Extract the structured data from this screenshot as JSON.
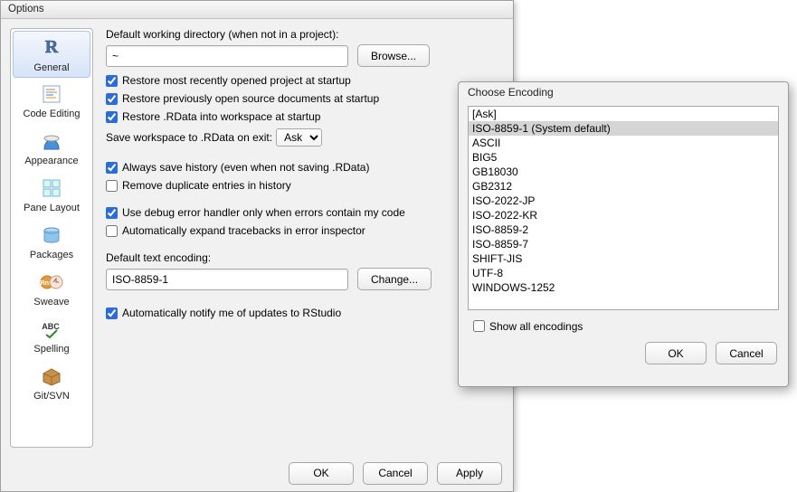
{
  "options": {
    "title": "Options",
    "sidebar": {
      "items": [
        {
          "key": "general",
          "label": "General"
        },
        {
          "key": "code_editing",
          "label": "Code Editing"
        },
        {
          "key": "appearance",
          "label": "Appearance"
        },
        {
          "key": "pane_layout",
          "label": "Pane Layout"
        },
        {
          "key": "packages",
          "label": "Packages"
        },
        {
          "key": "sweave",
          "label": "Sweave"
        },
        {
          "key": "spelling",
          "label": "Spelling"
        },
        {
          "key": "git_svn",
          "label": "Git/SVN"
        }
      ],
      "selected": "general"
    },
    "general": {
      "wd_label": "Default working directory (when not in a project):",
      "wd_value": "~",
      "browse_label": "Browse...",
      "restore_project": {
        "checked": true,
        "label": "Restore most recently opened project at startup"
      },
      "restore_docs": {
        "checked": true,
        "label": "Restore previously open source documents at startup"
      },
      "restore_rdata": {
        "checked": true,
        "label": "Restore .RData into workspace at startup"
      },
      "save_ws_label": "Save workspace to .RData on exit:",
      "save_ws_value": "Ask",
      "always_history": {
        "checked": true,
        "label": "Always save history (even when not saving .RData)"
      },
      "remove_dup": {
        "checked": false,
        "label": "Remove duplicate entries in history"
      },
      "debug_handler": {
        "checked": true,
        "label": "Use debug error handler only when errors contain my code"
      },
      "auto_expand": {
        "checked": false,
        "label": "Automatically expand tracebacks in error inspector"
      },
      "enc_label": "Default text encoding:",
      "enc_value": "ISO-8859-1",
      "change_label": "Change...",
      "auto_notify": {
        "checked": true,
        "label": "Automatically notify me of updates to RStudio"
      }
    },
    "buttons": {
      "ok": "OK",
      "cancel": "Cancel",
      "apply": "Apply"
    }
  },
  "encoding_dialog": {
    "title": "Choose Encoding",
    "items": [
      "[Ask]",
      "ISO-8859-1 (System default)",
      "ASCII",
      "BIG5",
      "GB18030",
      "GB2312",
      "ISO-2022-JP",
      "ISO-2022-KR",
      "ISO-8859-2",
      "ISO-8859-7",
      "SHIFT-JIS",
      "UTF-8",
      "WINDOWS-1252"
    ],
    "selected_index": 1,
    "show_all": {
      "checked": false,
      "label": "Show all encodings"
    },
    "ok": "OK",
    "cancel": "Cancel"
  }
}
